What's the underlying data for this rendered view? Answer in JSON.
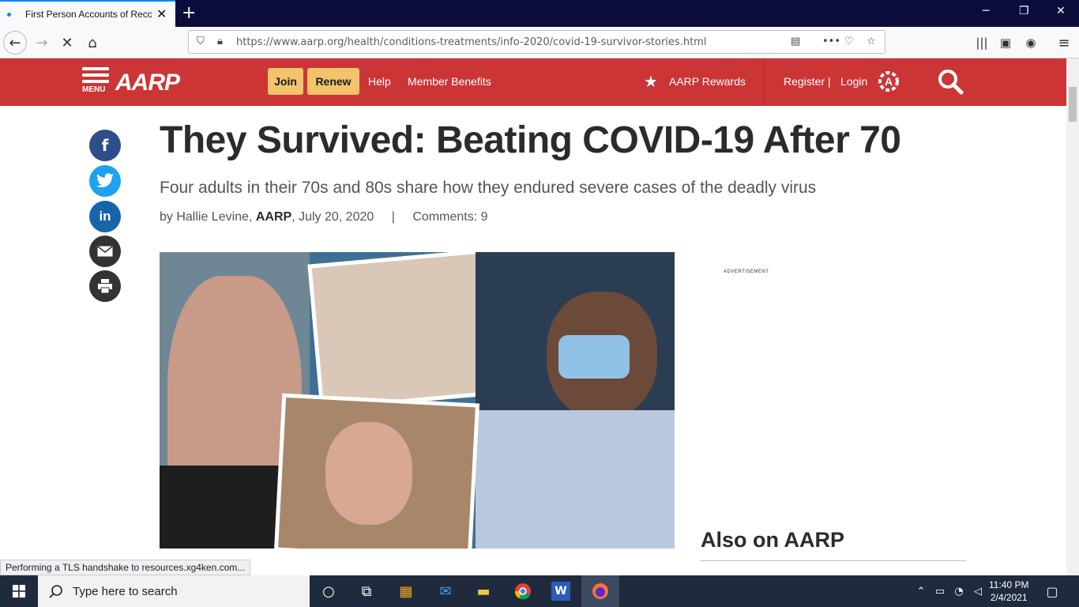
{
  "browser": {
    "tab_title": "First Person Accounts of Recov",
    "url": "https://www.aarp.org/health/conditions-treatments/info-2020/covid-19-survivor-stories.html",
    "status_text": "Performing a TLS handshake to resources.xg4ken.com..."
  },
  "header": {
    "menu_label": "MENU",
    "logo_text": "AARP",
    "join_label": "Join",
    "renew_label": "Renew",
    "help_label": "Help",
    "member_benefits_label": "Member Benefits",
    "rewards_label": "AARP Rewards",
    "register_label": "Register |",
    "login_label": "Login"
  },
  "article": {
    "title": "They Survived: Beating COVID-19 After 70",
    "subtitle": "Four adults in their 70s and 80s share how they endured severe cases of the deadly virus",
    "byline_prefix": "by Hallie Levine,",
    "byline_org": "AARP",
    "byline_date": ", July 20, 2020",
    "byline_sep": "|",
    "comments": "Comments: 9"
  },
  "sidebar": {
    "ad_label": "ADVERTISEMENT",
    "also_title": "Also on AARP"
  },
  "taskbar": {
    "search_placeholder": "Type here to search",
    "time": "11:40 PM",
    "date": "2/4/2021"
  },
  "colors": {
    "aarp_red": "#cc3535",
    "button_yellow": "#f3c46b",
    "facebook": "#2d4e8a",
    "twitter": "#1da1f2",
    "linkedin": "#1565a8",
    "dark_icon": "#333333"
  }
}
